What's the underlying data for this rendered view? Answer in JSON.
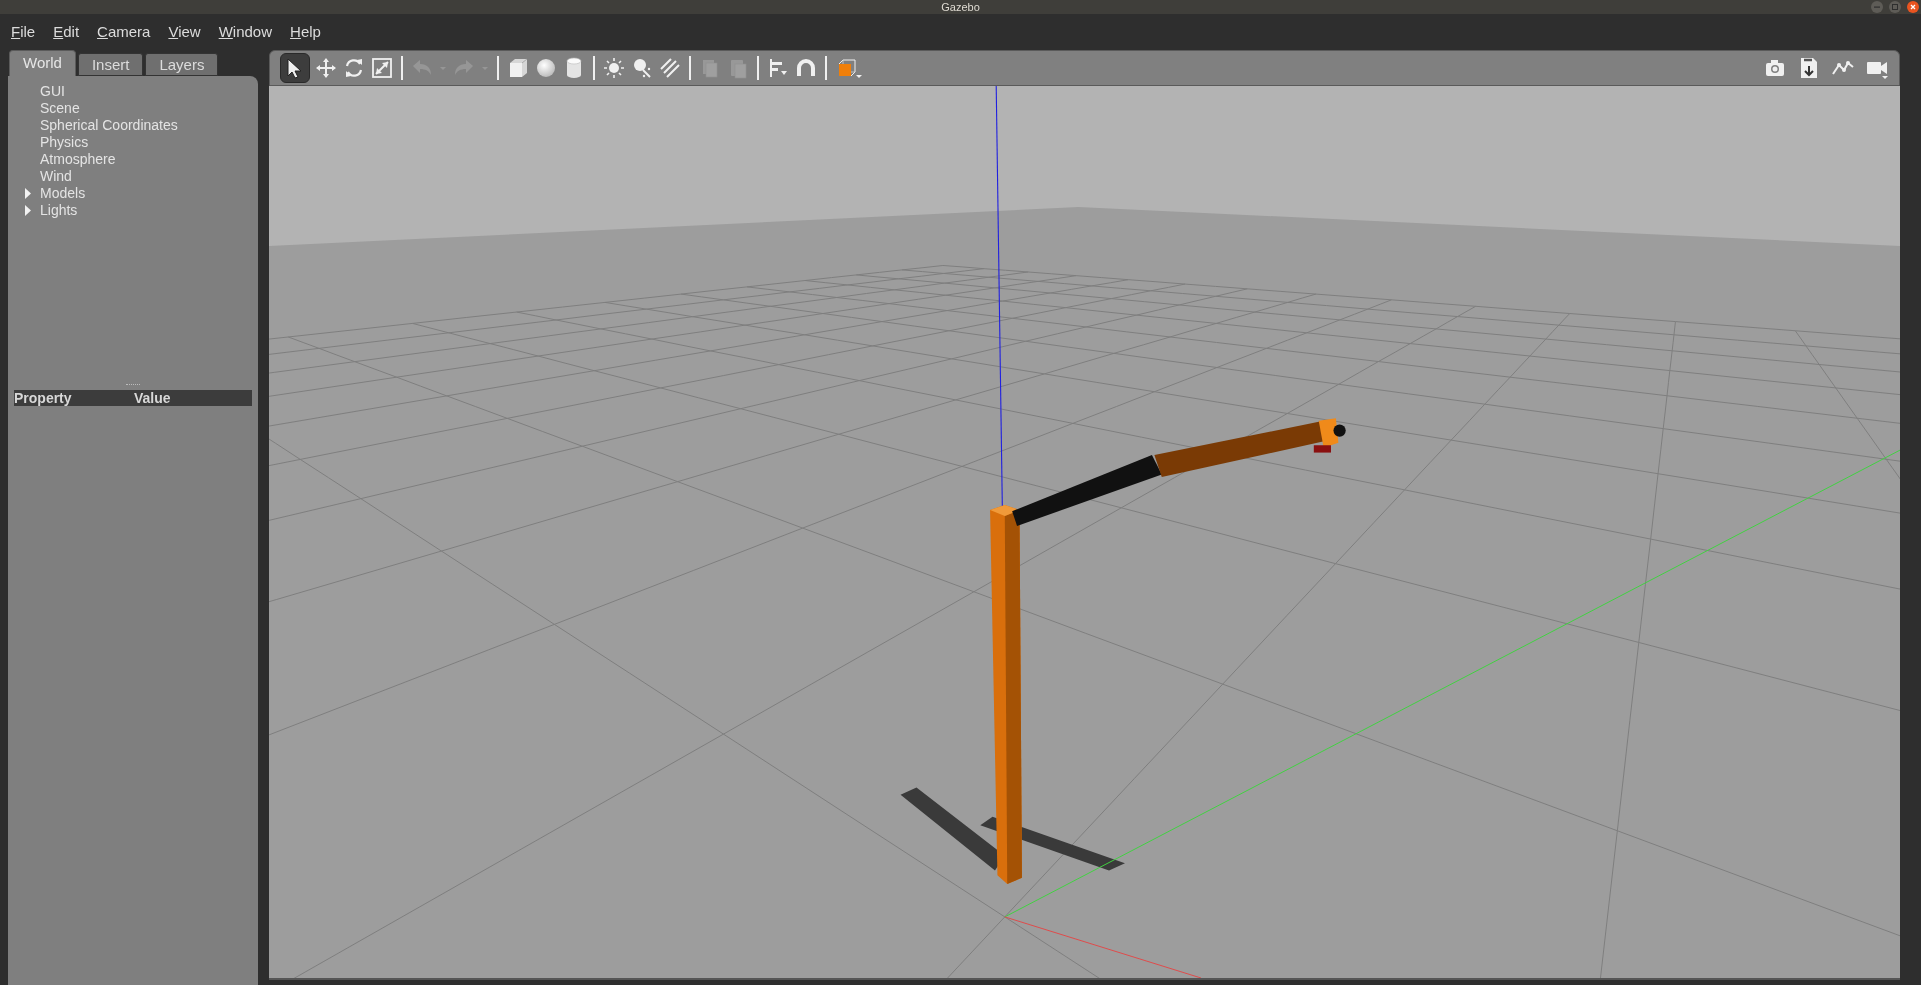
{
  "window": {
    "title": "Gazebo"
  },
  "menu": [
    "File",
    "Edit",
    "Camera",
    "View",
    "Window",
    "Help"
  ],
  "tabs": [
    {
      "label": "World",
      "selected": true
    },
    {
      "label": "Insert",
      "selected": false
    },
    {
      "label": "Layers",
      "selected": false
    }
  ],
  "tree": [
    {
      "label": "GUI",
      "kind": "leaf"
    },
    {
      "label": "Scene",
      "kind": "leaf"
    },
    {
      "label": "Spherical Coordinates",
      "kind": "leaf"
    },
    {
      "label": "Physics",
      "kind": "leaf"
    },
    {
      "label": "Atmosphere",
      "kind": "leaf"
    },
    {
      "label": "Wind",
      "kind": "leaf"
    },
    {
      "label": "Models",
      "kind": "group",
      "expanded": false
    },
    {
      "label": "Lights",
      "kind": "group",
      "expanded": false
    }
  ],
  "property_table": {
    "columns": [
      "Property",
      "Value"
    ]
  },
  "toolbar": {
    "tools": [
      {
        "kind": "select",
        "selected": true,
        "disabled": false
      },
      {
        "kind": "translate",
        "selected": false,
        "disabled": false
      },
      {
        "kind": "rotate",
        "selected": false,
        "disabled": false
      },
      {
        "kind": "scale",
        "selected": false,
        "disabled": false
      },
      {
        "kind": "separator"
      },
      {
        "kind": "undo",
        "selected": false,
        "disabled": true
      },
      {
        "kind": "caret",
        "selected": false,
        "disabled": true
      },
      {
        "kind": "redo",
        "selected": false,
        "disabled": true
      },
      {
        "kind": "caret",
        "selected": false,
        "disabled": true
      },
      {
        "kind": "separator"
      },
      {
        "kind": "box",
        "selected": false,
        "disabled": false
      },
      {
        "kind": "sphere",
        "selected": false,
        "disabled": false
      },
      {
        "kind": "cylinder",
        "selected": false,
        "disabled": false
      },
      {
        "kind": "separator"
      },
      {
        "kind": "sun",
        "selected": false,
        "disabled": false
      },
      {
        "kind": "point",
        "selected": false,
        "disabled": false
      },
      {
        "kind": "spot",
        "selected": false,
        "disabled": false
      },
      {
        "kind": "separator"
      },
      {
        "kind": "copy",
        "selected": false,
        "disabled": true
      },
      {
        "kind": "paste",
        "selected": false,
        "disabled": true
      },
      {
        "kind": "separator"
      },
      {
        "kind": "align",
        "selected": false,
        "disabled": false
      },
      {
        "kind": "magnet",
        "selected": false,
        "disabled": false
      },
      {
        "kind": "separator"
      },
      {
        "kind": "view",
        "selected": false,
        "disabled": false
      }
    ],
    "right_tools": [
      {
        "kind": "screenshot"
      },
      {
        "kind": "log"
      },
      {
        "kind": "plot"
      },
      {
        "kind": "video"
      }
    ]
  }
}
